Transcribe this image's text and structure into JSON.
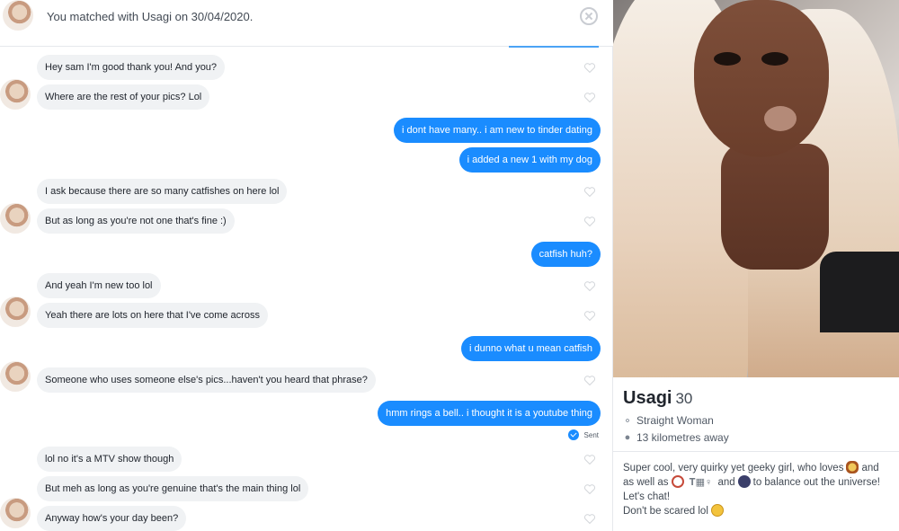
{
  "header": {
    "match_text": "You matched with Usagi on 30/04/2020."
  },
  "messages": [
    {
      "dir": "in",
      "text": "Hey sam I'm good thank you! And you?"
    },
    {
      "dir": "in",
      "text": "Where are the rest of your pics? Lol"
    },
    {
      "dir": "out",
      "text": "i dont have many.. i am new to tinder dating"
    },
    {
      "dir": "out",
      "text": "i added a new 1 with my dog"
    },
    {
      "dir": "in",
      "text": "I ask because there are so many catfishes on here lol"
    },
    {
      "dir": "in",
      "text": "But as long as you're not one that's fine :)"
    },
    {
      "dir": "out",
      "text": "catfish huh?"
    },
    {
      "dir": "in",
      "text": "And yeah I'm new too lol"
    },
    {
      "dir": "in",
      "text": "Yeah there are lots on here that I've come across"
    },
    {
      "dir": "out",
      "text": "i dunno what u mean catfish"
    },
    {
      "dir": "in",
      "text": "Someone who uses someone else's pics...haven't you heard that phrase?"
    },
    {
      "dir": "out",
      "text": "hmm rings a bell.. i thought it is a youtube thing"
    },
    {
      "dir": "in",
      "text": "lol no it's a MTV show though"
    },
    {
      "dir": "in",
      "text": "But meh as long as you're genuine that's the main thing lol"
    },
    {
      "dir": "in",
      "text": "Anyway how's your day been?"
    }
  ],
  "sent_status": "Sent",
  "profile": {
    "name": "Usagi",
    "age": "30",
    "orientation": "Straight Woman",
    "distance": "13 kilometres away",
    "bio": {
      "line1_a": "Super cool, very quirky yet geeky girl, who loves",
      "line1_b": "and",
      "line2_a": "as well as",
      "line2_b": "and",
      "line2_c": "to balance out the universe!",
      "line3": "Let's chat!",
      "line4": "Don't be scared lol"
    }
  },
  "icons": {
    "tools_glyph": "𝐓▦♀"
  },
  "colors": {
    "outgoing_bubble": "#1a8cff",
    "incoming_bubble": "#f0f2f4",
    "accent_line": "#4ba3f5"
  }
}
